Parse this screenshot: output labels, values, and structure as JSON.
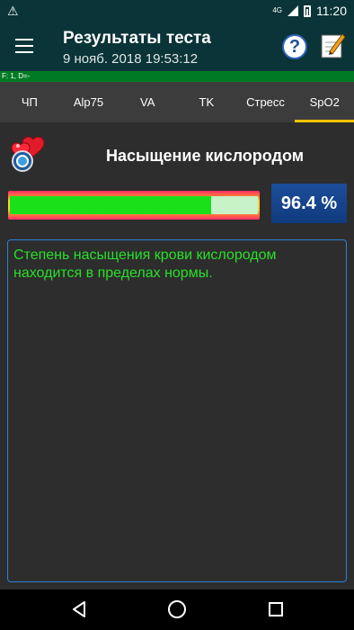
{
  "status_bar": {
    "time": "11:20",
    "network": "4G",
    "warning_icon": "warning-icon"
  },
  "app_bar": {
    "title": "Результаты теста",
    "subtitle": "9 нояб. 2018  19:53:12",
    "help_icon": "help-icon",
    "note_icon": "note-icon"
  },
  "info_strip": {
    "text": "F: 1, D=-"
  },
  "tabs": [
    {
      "label": "ЧП"
    },
    {
      "label": "Alp75"
    },
    {
      "label": "VA"
    },
    {
      "label": "TK"
    },
    {
      "label": "Стресс"
    },
    {
      "label": "SpO2",
      "active": true
    }
  ],
  "section": {
    "title": "Насыщение кислородом",
    "value_text": "96.4 %",
    "level_fraction": 0.81,
    "message": "Степень насыщения крови кислородом находится в пределах нормы."
  },
  "colors": {
    "app_bar": "#0a3437",
    "strip": "#017a24",
    "active_tab": "#f5c400",
    "message_text": "#28e028",
    "value_box": "#1c4e9a"
  }
}
